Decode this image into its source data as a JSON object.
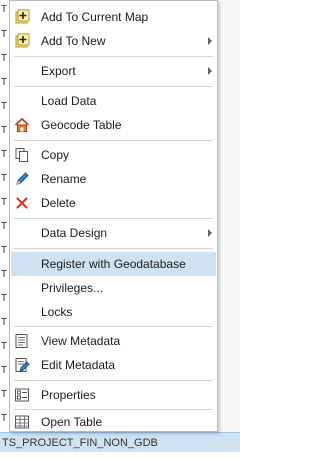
{
  "menu": {
    "items": [
      {
        "label": "Add To Current Map",
        "icon": "add-layer-icon",
        "submenu": false
      },
      {
        "label": "Add To New",
        "icon": "add-layer-icon",
        "submenu": true
      },
      {
        "label": "Export",
        "icon": "",
        "submenu": true
      },
      {
        "label": "Load Data",
        "icon": "",
        "submenu": false
      },
      {
        "label": "Geocode Table",
        "icon": "geocode-house-icon",
        "submenu": false
      },
      {
        "label": "Copy",
        "icon": "copy-icon",
        "submenu": false
      },
      {
        "label": "Rename",
        "icon": "pencil-icon",
        "submenu": false
      },
      {
        "label": "Delete",
        "icon": "delete-x-icon",
        "submenu": false
      },
      {
        "label": "Data Design",
        "icon": "",
        "submenu": true
      },
      {
        "label": "Register with Geodatabase",
        "icon": "",
        "submenu": false,
        "hovered": true
      },
      {
        "label": "Privileges...",
        "icon": "",
        "submenu": false
      },
      {
        "label": "Locks",
        "icon": "",
        "submenu": false
      },
      {
        "label": "View Metadata",
        "icon": "view-metadata-icon",
        "submenu": false
      },
      {
        "label": "Edit Metadata",
        "icon": "edit-metadata-icon",
        "submenu": false
      },
      {
        "label": "Properties",
        "icon": "properties-icon",
        "submenu": false
      },
      {
        "label": "Open Table",
        "icon": "table-icon",
        "submenu": false
      }
    ]
  },
  "background": {
    "row_letter": "T",
    "selected_row_label": "TS_PROJECT_FIN_NON_GDB"
  },
  "colors": {
    "hover": "#cfe2f3",
    "selected_row": "#cde3f4"
  }
}
